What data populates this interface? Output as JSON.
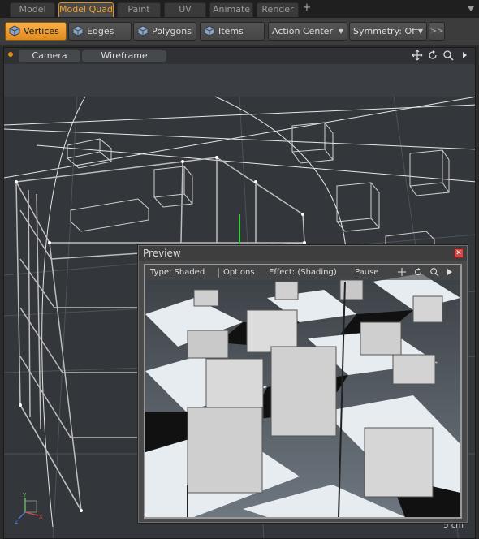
{
  "tabs": [
    {
      "label": "Model",
      "active": false
    },
    {
      "label": "Model Quad",
      "active": true
    },
    {
      "label": "Paint",
      "active": false
    },
    {
      "label": "UV",
      "active": false
    },
    {
      "label": "Animate",
      "active": false
    },
    {
      "label": "Render",
      "active": false
    }
  ],
  "tab_add": "+",
  "toolbar": {
    "vertices": "Vertices",
    "edges": "Edges",
    "polygons": "Polygons",
    "items": "Items",
    "action_center": "Action Center",
    "symmetry": "Symmetry: Off",
    "more": ">>"
  },
  "viewport": {
    "camera": "Camera",
    "wireframe": "Wireframe",
    "scale": "5 cm"
  },
  "preview": {
    "title": "Preview",
    "type": "Type: Shaded",
    "options": "Options",
    "effect": "Effect: (Shading)",
    "pause": "Pause"
  },
  "colors": {
    "accent": "#e08a1e",
    "active_tab_text": "#f0a030",
    "close": "#d24747"
  }
}
